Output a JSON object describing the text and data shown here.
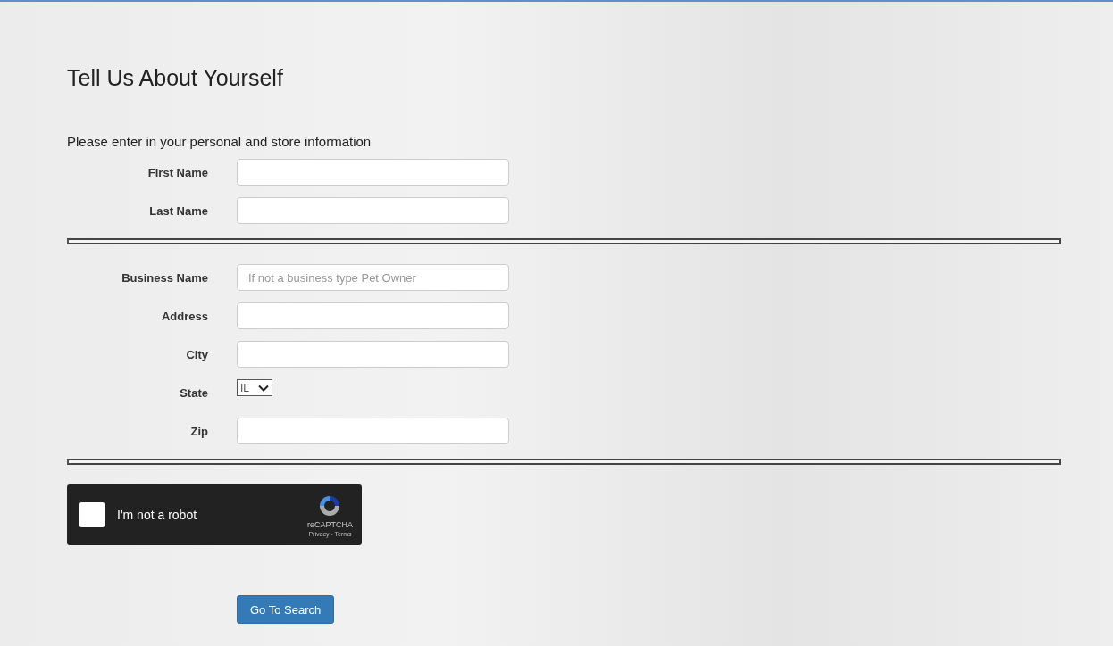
{
  "page": {
    "title": "Tell Us About Yourself",
    "instructions": "Please enter in your personal and store information"
  },
  "sections": [
    {
      "fields": [
        {
          "label": "First Name",
          "kind": "text"
        },
        {
          "label": "Last Name",
          "kind": "text"
        }
      ]
    },
    {
      "fields": [
        {
          "label": "Business Name",
          "kind": "text",
          "placeholder": "If not a business type Pet Owner"
        },
        {
          "label": "Address",
          "kind": "text"
        },
        {
          "label": "City",
          "kind": "text"
        },
        {
          "label": "State",
          "kind": "select",
          "value": "IL"
        },
        {
          "label": "Zip",
          "kind": "text"
        }
      ]
    }
  ],
  "captcha": {
    "label": "I'm not a robot",
    "checked": false,
    "brand": "reCAPTCHA",
    "links": "Privacy - Terms"
  },
  "submit_button": "Go To Search"
}
